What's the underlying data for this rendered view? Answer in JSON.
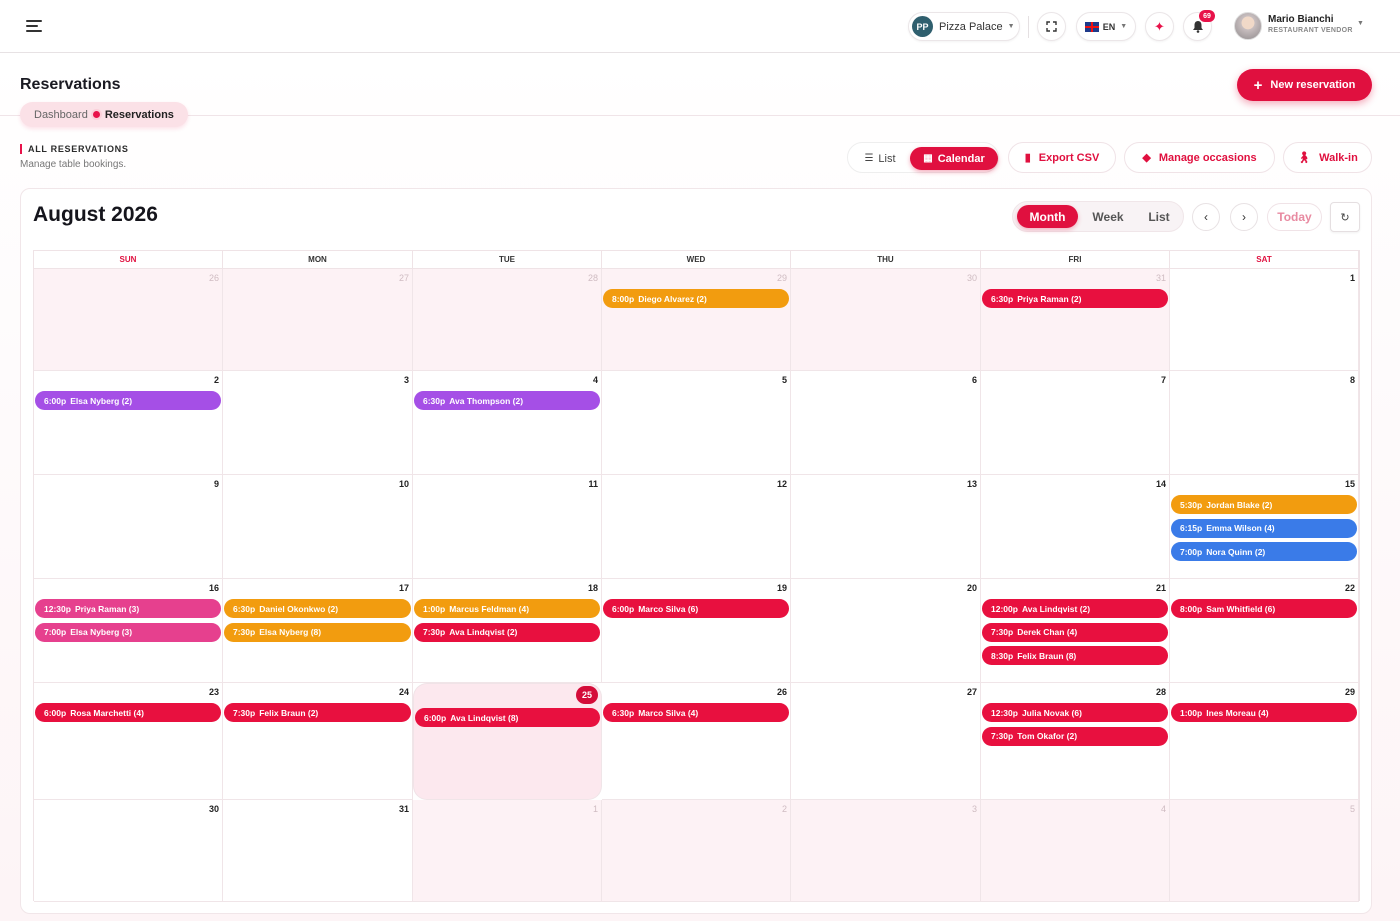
{
  "header": {
    "restaurant_initials": "PP",
    "restaurant_name": "Pizza Palace",
    "language": "EN",
    "notification_count": "69",
    "user_name": "Mario Bianchi",
    "user_role": "RESTAURANT VENDOR"
  },
  "page": {
    "title": "Reservations",
    "breadcrumb": [
      "Dashboard",
      "Reservations"
    ],
    "new_button": "New reservation",
    "section_label": "ALL RESERVATIONS",
    "section_subtitle": "Manage table bookings."
  },
  "toolbar": {
    "list_label": "List",
    "calendar_label": "Calendar",
    "export_label": "Export CSV",
    "occasions_label": "Manage occasions",
    "walkin_label": "Walk-in"
  },
  "calendar": {
    "month_title": "August 2026",
    "views": [
      "Month",
      "Week",
      "List"
    ],
    "today_label": "Today",
    "weekdays": [
      "SUN",
      "MON",
      "TUE",
      "WED",
      "THU",
      "FRI",
      "SAT"
    ],
    "colors": {
      "red": "#e8103f",
      "orange": "#f29c0f",
      "purple": "#a54fe6",
      "blue": "#3a7be8",
      "pink": "#e6408e"
    },
    "weeks": [
      [
        {
          "day": "26",
          "other": true,
          "events": []
        },
        {
          "day": "27",
          "other": true,
          "events": []
        },
        {
          "day": "28",
          "other": true,
          "events": []
        },
        {
          "day": "29",
          "other": true,
          "events": [
            {
              "time": "8:00p",
              "name": "Diego Alvarez (2)",
              "color": "orange"
            }
          ]
        },
        {
          "day": "30",
          "other": true,
          "events": []
        },
        {
          "day": "31",
          "other": true,
          "events": [
            {
              "time": "6:30p",
              "name": "Priya Raman (2)",
              "color": "red"
            }
          ]
        },
        {
          "day": "1",
          "events": []
        }
      ],
      [
        {
          "day": "2",
          "events": [
            {
              "time": "6:00p",
              "name": "Elsa Nyberg (2)",
              "color": "purple"
            }
          ]
        },
        {
          "day": "3",
          "events": []
        },
        {
          "day": "4",
          "events": [
            {
              "time": "6:30p",
              "name": "Ava Thompson (2)",
              "color": "purple"
            }
          ]
        },
        {
          "day": "5",
          "events": []
        },
        {
          "day": "6",
          "events": []
        },
        {
          "day": "7",
          "events": []
        },
        {
          "day": "8",
          "events": []
        }
      ],
      [
        {
          "day": "9",
          "events": []
        },
        {
          "day": "10",
          "events": []
        },
        {
          "day": "11",
          "events": []
        },
        {
          "day": "12",
          "events": []
        },
        {
          "day": "13",
          "events": []
        },
        {
          "day": "14",
          "events": []
        },
        {
          "day": "15",
          "events": [
            {
              "time": "5:30p",
              "name": "Jordan Blake (2)",
              "color": "orange"
            },
            {
              "time": "6:15p",
              "name": "Emma Wilson (4)",
              "color": "blue"
            },
            {
              "time": "7:00p",
              "name": "Nora Quinn (2)",
              "color": "blue"
            }
          ]
        }
      ],
      [
        {
          "day": "16",
          "events": [
            {
              "time": "12:30p",
              "name": "Priya Raman (3)",
              "color": "pink"
            },
            {
              "time": "7:00p",
              "name": "Elsa Nyberg (3)",
              "color": "pink"
            }
          ]
        },
        {
          "day": "17",
          "events": [
            {
              "time": "6:30p",
              "name": "Daniel Okonkwo (2)",
              "color": "orange"
            },
            {
              "time": "7:30p",
              "name": "Elsa Nyberg (8)",
              "color": "orange"
            }
          ]
        },
        {
          "day": "18",
          "events": [
            {
              "time": "1:00p",
              "name": "Marcus Feldman (4)",
              "color": "orange"
            },
            {
              "time": "7:30p",
              "name": "Ava Lindqvist (2)",
              "color": "red"
            }
          ]
        },
        {
          "day": "19",
          "events": [
            {
              "time": "6:00p",
              "name": "Marco Silva (6)",
              "color": "red"
            }
          ]
        },
        {
          "day": "20",
          "events": []
        },
        {
          "day": "21",
          "events": [
            {
              "time": "12:00p",
              "name": "Ava Lindqvist (2)",
              "color": "red"
            },
            {
              "time": "7:30p",
              "name": "Derek Chan (4)",
              "color": "red"
            },
            {
              "time": "8:30p",
              "name": "Felix Braun (8)",
              "color": "red"
            }
          ]
        },
        {
          "day": "22",
          "events": [
            {
              "time": "8:00p",
              "name": "Sam Whitfield (6)",
              "color": "red"
            }
          ]
        }
      ],
      [
        {
          "day": "23",
          "events": [
            {
              "time": "6:00p",
              "name": "Rosa Marchetti (4)",
              "color": "red"
            }
          ]
        },
        {
          "day": "24",
          "events": [
            {
              "time": "7:30p",
              "name": "Felix Braun (2)",
              "color": "red"
            }
          ]
        },
        {
          "day": "25",
          "today": true,
          "events": [
            {
              "time": "6:00p",
              "name": "Ava Lindqvist (8)",
              "color": "red"
            }
          ]
        },
        {
          "day": "26",
          "events": [
            {
              "time": "6:30p",
              "name": "Marco Silva (4)",
              "color": "red"
            }
          ]
        },
        {
          "day": "27",
          "events": []
        },
        {
          "day": "28",
          "events": [
            {
              "time": "12:30p",
              "name": "Julia Novak (6)",
              "color": "red"
            },
            {
              "time": "7:30p",
              "name": "Tom Okafor (2)",
              "color": "red"
            }
          ]
        },
        {
          "day": "29",
          "events": [
            {
              "time": "1:00p",
              "name": "Ines Moreau (4)",
              "color": "red"
            }
          ]
        }
      ],
      [
        {
          "day": "30",
          "events": []
        },
        {
          "day": "31",
          "events": []
        },
        {
          "day": "1",
          "other": true,
          "events": []
        },
        {
          "day": "2",
          "other": true,
          "events": []
        },
        {
          "day": "3",
          "other": true,
          "events": []
        },
        {
          "day": "4",
          "other": true,
          "events": []
        },
        {
          "day": "5",
          "other": true,
          "events": []
        }
      ]
    ]
  }
}
